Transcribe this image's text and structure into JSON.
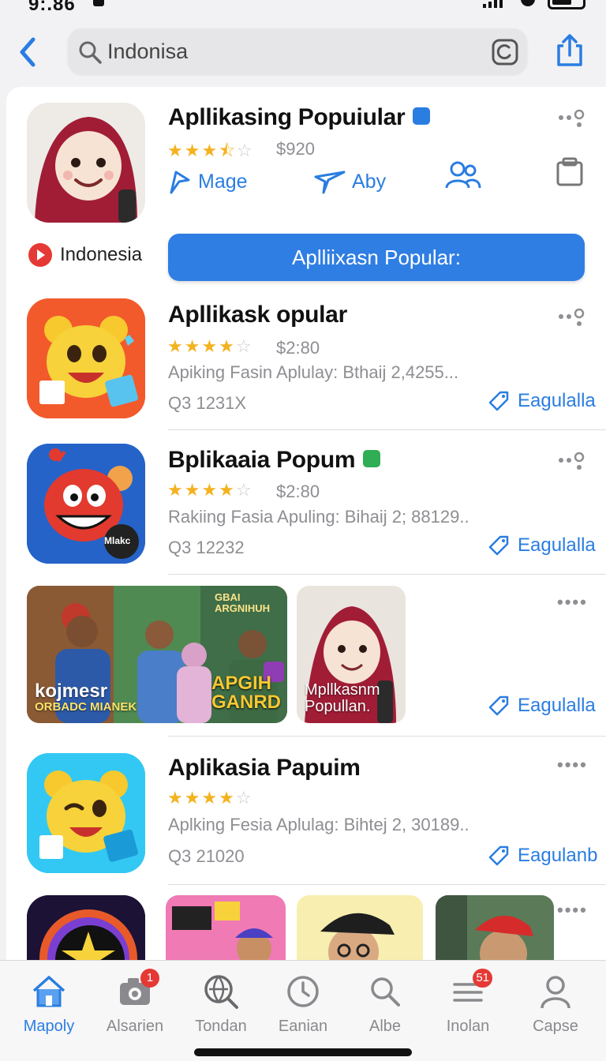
{
  "status_bar": {
    "time": "9:.86"
  },
  "search": {
    "value": "Indonisa",
    "placeholder": "Indonisa"
  },
  "featured": {
    "title": "Apllikasing Popuiular",
    "rating_stars": 3.5,
    "price": "$920",
    "actions": [
      {
        "label": "Mage"
      },
      {
        "label": "Aby"
      }
    ],
    "country": "Indonesia",
    "get_label": "Aplliixasn Popular:"
  },
  "apps": [
    {
      "title": "Apllikask opular",
      "rating_stars": 4,
      "price": "$2:80",
      "desc": "Apiking Fasin Aplulay: Bthaij 2,4255...",
      "meta": "Q3 1231X",
      "link": "Eagulalla"
    },
    {
      "title": "Bplikaaia Popum",
      "rating_stars": 4,
      "price": "$2:80",
      "desc": "Rakiing Fasia Apuling: Bihaij 2; 88129..",
      "meta": "Q3 12232",
      "link": "Eagulalla",
      "icon_tag": "Mlakc"
    },
    {
      "title": "Aplikasia Papuim",
      "rating_stars": 4,
      "price": "",
      "desc": "Aplking Fesia Aplulag: Bihtej 2, 30189..",
      "meta": "Q3 21020",
      "link": "Eagulanb"
    }
  ],
  "banner": {
    "thumb1_title": "kojmesr",
    "thumb1_sub": "ORBADC MIANEK",
    "thumb2_title": "APGIH GANRD",
    "thumb2_top": "GBAI ARGNIHUH",
    "thumb3_title": "Mpllkasnm Popullan.",
    "link": "Eagulalla"
  },
  "tabs": [
    {
      "label": "Mapoly",
      "icon": "home-icon",
      "active": true
    },
    {
      "label": "Alsarien",
      "icon": "camera-icon",
      "badge": "1"
    },
    {
      "label": "Tondan",
      "icon": "globe-search-icon"
    },
    {
      "label": "Eanian",
      "icon": "clock-icon"
    },
    {
      "label": "Albe",
      "icon": "search-icon"
    },
    {
      "label": "Inolan",
      "icon": "list-icon",
      "badge": "51"
    },
    {
      "label": "Capse",
      "icon": "person-icon"
    }
  ],
  "colors": {
    "accent": "#2a7de1",
    "star": "#f4b21f",
    "badge": "#e53935"
  }
}
